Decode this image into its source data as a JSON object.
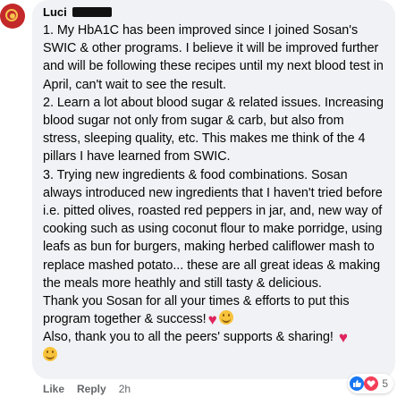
{
  "comment": {
    "author": "Luci",
    "paragraphs": [
      {
        "text": "1. My HbA1C has been improved since I joined Sosan's SWIC & other programs. I believe it will be improved further and will be following these recipes until my next blood test in April, can't wait to see the result.",
        "emoji": []
      },
      {
        "text": "2. Learn a lot about blood sugar & related issues. Increasing blood sugar not only from sugar & carb, but also from stress, sleeping quality, etc. This makes me think of the 4 pillars I have learned from SWIC.",
        "emoji": []
      },
      {
        "text": "3. Trying new ingredients & food combinations. Sosan always introduced new ingredients that I haven't tried before i.e. pitted olives, roasted red peppers in jar, and, new way of cooking such as using coconut flour to make porridge, using leafs as bun for burgers, making herbed califlower mash to replace mashed potato... these are all great ideas & making the meals more heathly and still tasty & delicious.",
        "emoji": []
      },
      {
        "text": "Thank you Sosan for all your times & efforts to put this program together & success!",
        "emoji": [
          "heart",
          "smile"
        ]
      },
      {
        "text": "Also, thank you to all the peers' supports & sharing!",
        "emoji": [
          "heart",
          "smile"
        ]
      }
    ]
  },
  "actions": {
    "like": "Like",
    "reply": "Reply",
    "time": "2h"
  },
  "reactions": {
    "count": "5",
    "icons": [
      "like-icon",
      "love-icon"
    ]
  },
  "colors": {
    "bubble": "#f0f2f5",
    "text": "#050505",
    "meta": "#65676b",
    "like": "#1877f2",
    "love": "#f33e58"
  }
}
